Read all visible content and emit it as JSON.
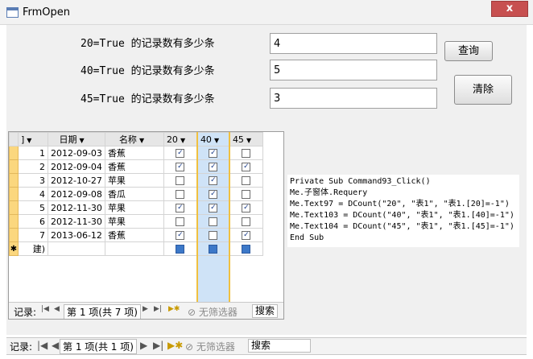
{
  "window": {
    "title": "FrmOpen",
    "close_label": "x"
  },
  "form": {
    "rows": [
      {
        "label": "20=True 的记录数有多少条",
        "value": "4"
      },
      {
        "label": "40=True 的记录数有多少条",
        "value": "5"
      },
      {
        "label": "45=True 的记录数有多少条",
        "value": "3"
      }
    ],
    "query_button": "查询",
    "clear_button": "清除"
  },
  "subform": {
    "columns": [
      "]",
      "日期",
      "名称",
      "20",
      "40",
      "45"
    ],
    "rows": [
      {
        "id": "1",
        "date": "2012-09-03",
        "name": "香蕉",
        "c20": true,
        "c40": true,
        "c45": false
      },
      {
        "id": "2",
        "date": "2012-09-04",
        "name": "香蕉",
        "c20": true,
        "c40": true,
        "c45": true
      },
      {
        "id": "3",
        "date": "2012-10-27",
        "name": "苹果",
        "c20": false,
        "c40": true,
        "c45": false
      },
      {
        "id": "4",
        "date": "2012-09-08",
        "name": "香瓜",
        "c20": false,
        "c40": true,
        "c45": false
      },
      {
        "id": "5",
        "date": "2012-11-30",
        "name": "苹果",
        "c20": true,
        "c40": true,
        "c45": true
      },
      {
        "id": "6",
        "date": "2012-11-30",
        "name": "苹果",
        "c20": false,
        "c40": false,
        "c45": false
      },
      {
        "id": "7",
        "date": "2013-06-12",
        "name": "香蕉",
        "c20": true,
        "c40": false,
        "c45": true
      }
    ],
    "new_row_marker": "✱",
    "new_row_id": "建)",
    "nav": {
      "record_label": "记录:",
      "position": "第 1 项(共 7 项)",
      "filter": "无筛选器",
      "search": "搜索"
    }
  },
  "code": [
    "Private Sub Command93_Click()",
    "Me.子窗体.Requery",
    "Me.Text97 = DCount(\"20\", \"表1\", \"表1.[20]=-1\")",
    "Me.Text103 = DCount(\"40\", \"表1\", \"表1.[40]=-1\")",
    "Me.Text104 = DCount(\"45\", \"表1\", \"表1.[45]=-1\")",
    "End Sub"
  ],
  "outer_nav": {
    "record_label": "记录:",
    "position": "第 1 项(共 1 项)",
    "filter": "无筛选器",
    "search": "搜索"
  }
}
